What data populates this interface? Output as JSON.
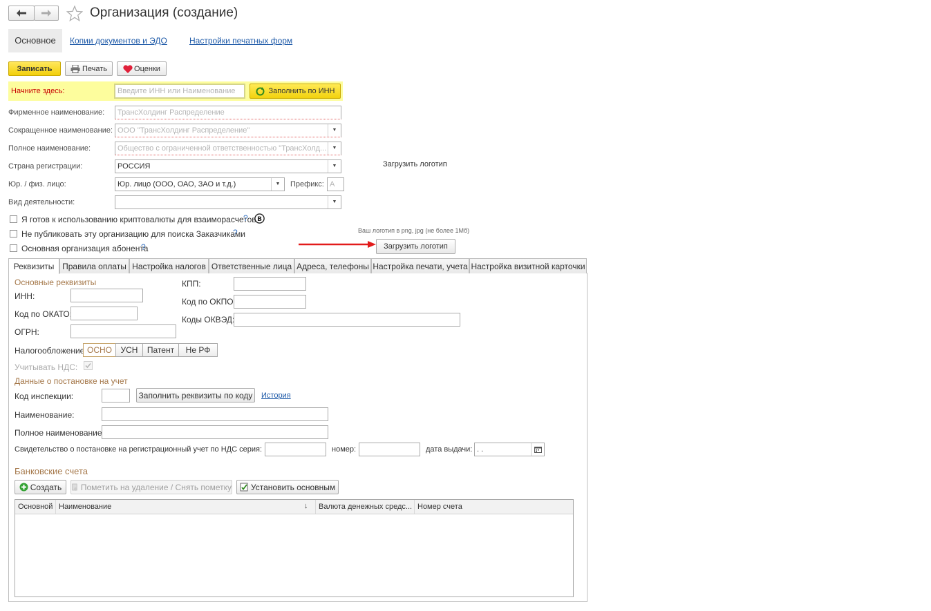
{
  "window": {
    "title": "Организация (создание)"
  },
  "nav_tabs": {
    "main": "Основное",
    "copies": "Копии документов и ЭДО",
    "print_forms": "Настройки печатных форм"
  },
  "toolbar": {
    "save": "Записать",
    "print": "Печать",
    "ratings": "Оценки"
  },
  "start": {
    "label": "Начните здесь:",
    "placeholder": "Введите ИНН или Наименование",
    "fill_button": "Заполнить по ИНН"
  },
  "form": {
    "firm_name_label": "Фирменное наименование:",
    "firm_name_value": "ТрансХолдинг Распределение",
    "short_name_label": "Сокращенное наименование:",
    "short_name_value": "ООО \"ТрансХолдинг Распределение\"",
    "full_name_label": "Полное наименование:",
    "full_name_value": "Общество с ограниченной ответственностью \"ТрансХолд...",
    "country_label": "Страна регистрации:",
    "country_value": "РОССИЯ",
    "entity_label": "Юр. / физ. лицо:",
    "entity_value": "Юр. лицо (ООО, ОАО, ЗАО и т.д.)",
    "prefix_label": "Префикс:",
    "prefix_value": "А",
    "activity_label": "Вид деятельности:",
    "activity_value": ""
  },
  "checks": {
    "crypto": "Я готов к использованию криптовалюты для взаиморасчетов",
    "no_publish": "Не публиковать эту организацию для поиска Заказчиками",
    "main_org": "Основная организация абонента",
    "help": "?"
  },
  "logo": {
    "title": "Загрузить логотип",
    "hint": "Ваш логотип в png, jpg (не более 1Мб)",
    "button": "Загрузить логотип"
  },
  "tabs": [
    "Реквизиты",
    "Правила оплаты",
    "Настройка налогов",
    "Ответственные лица",
    "Адреса, телефоны",
    "Настройка печати, учета",
    "Настройка визитной карточки"
  ],
  "requisites": {
    "section_main": "Основные реквизиты",
    "inn": "ИНН:",
    "kpp": "КПП:",
    "okato": "Код по ОКАТО:",
    "okpo": "Код по ОКПО:",
    "ogrn": "ОГРН:",
    "okved": "Коды ОКВЭД:",
    "taxation_label": "Налогообложение:",
    "taxation_options": [
      "ОСНО",
      "УСН",
      "Патент",
      "Не РФ"
    ],
    "vat_label": "Учитывать НДС:",
    "section_reg": "Данные о постановке на учет",
    "inspection_label": "Код инспекции:",
    "fill_by_code": "Заполнить реквизиты по коду",
    "history": "История",
    "name_label": "Наименование:",
    "full_name_label": "Полное наименование:",
    "cert_label": "Свидетельство о постановке на регистрационный учет по НДС серия:",
    "number_label": "номер:",
    "date_label": "дата выдачи:",
    "date_value": " .  ."
  },
  "bank": {
    "title": "Банковские счета",
    "create": "Создать",
    "mark_delete": "Пометить на удаление / Снять пометку",
    "set_main": "Установить основным",
    "columns": [
      "Основной",
      "Наименование",
      "Валюта денежных средс...",
      "Номер счета"
    ],
    "sort_arrow": "↓"
  },
  "colors": {
    "save_yellow": "#f5d51a",
    "highlight_yellow": "#fdfd9d",
    "section_brown": "#a5784a",
    "link_blue": "#1e5aa8",
    "red_label": "#c80000"
  }
}
